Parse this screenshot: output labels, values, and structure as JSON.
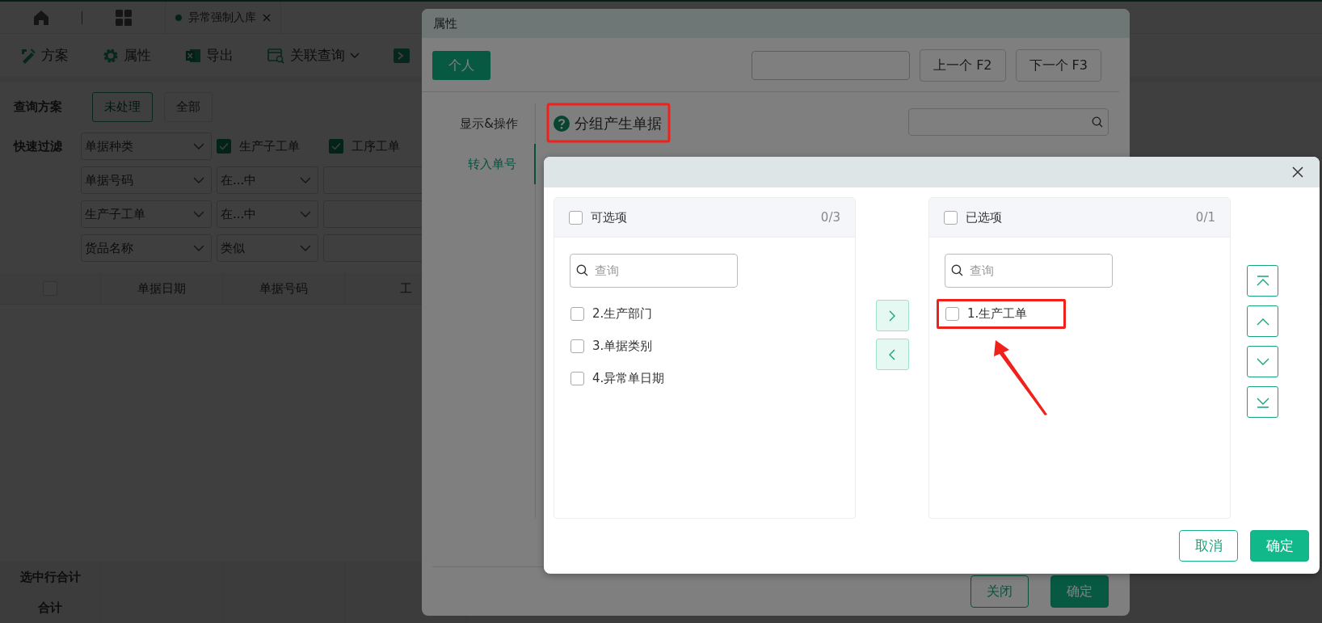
{
  "tab_bar": {
    "tabs": [
      {
        "label": "异常强制入库",
        "selected": true
      }
    ]
  },
  "toolbar": [
    {
      "kind": "plan",
      "label": "方案"
    },
    {
      "kind": "settings",
      "label": "属性"
    },
    {
      "kind": "excel",
      "label": "导出"
    },
    {
      "kind": "query",
      "label": "关联查询",
      "dropdown": true
    },
    {
      "kind": "run"
    }
  ],
  "query_scheme": {
    "label": "查询方案",
    "options": [
      {
        "label": "未处理",
        "selected": true
      },
      {
        "label": "全部",
        "selected": false
      }
    ]
  },
  "quick_filter": {
    "label": "快速过滤",
    "type_select": "单据种类",
    "checkboxes": [
      {
        "label": "生产子工单",
        "checked": true
      },
      {
        "label": "工序工单",
        "checked": true
      }
    ],
    "rows": [
      {
        "field": "单据号码",
        "operator": "在...中"
      },
      {
        "field": "生产子工单",
        "operator": "在...中"
      },
      {
        "field": "货品名称",
        "operator": "类似"
      }
    ]
  },
  "table": {
    "select_all_checked": false,
    "columns": [
      "单据日期",
      "单据号码",
      "工"
    ],
    "footer": [
      "选中行合计",
      "合计"
    ]
  },
  "properties_dialog": {
    "title": "属性",
    "tabs": [
      {
        "label": "个人",
        "selected": true
      }
    ],
    "nav_buttons": [
      "上一个 F2",
      "下一个 F3"
    ],
    "nav": [
      {
        "label": "显示&操作",
        "selected": false
      },
      {
        "label": "转入单号",
        "selected": true
      }
    ],
    "heading": {
      "text": "分组产生单据",
      "annotated": true
    },
    "buttons": [
      {
        "label": "关闭",
        "kind": "secondary"
      },
      {
        "label": "确定",
        "kind": "primary"
      }
    ]
  },
  "transfer_dialog": {
    "panels": [
      {
        "title": "可选项",
        "count": "0/3",
        "checked": false,
        "search_placeholder": "查询",
        "items": [
          {
            "label": "2.生产部门",
            "checked": false,
            "annotated": false
          },
          {
            "label": "3.单据类别",
            "checked": false,
            "annotated": false
          },
          {
            "label": "4.异常单日期",
            "checked": false,
            "annotated": false
          }
        ]
      },
      {
        "title": "已选项",
        "count": "0/1",
        "checked": false,
        "search_placeholder": "查询",
        "items": [
          {
            "label": "1.生产工单",
            "checked": false,
            "annotated": true
          }
        ]
      }
    ],
    "buttons": [
      {
        "label": "取消",
        "kind": "secondary"
      },
      {
        "label": "确定",
        "kind": "primary"
      }
    ]
  }
}
